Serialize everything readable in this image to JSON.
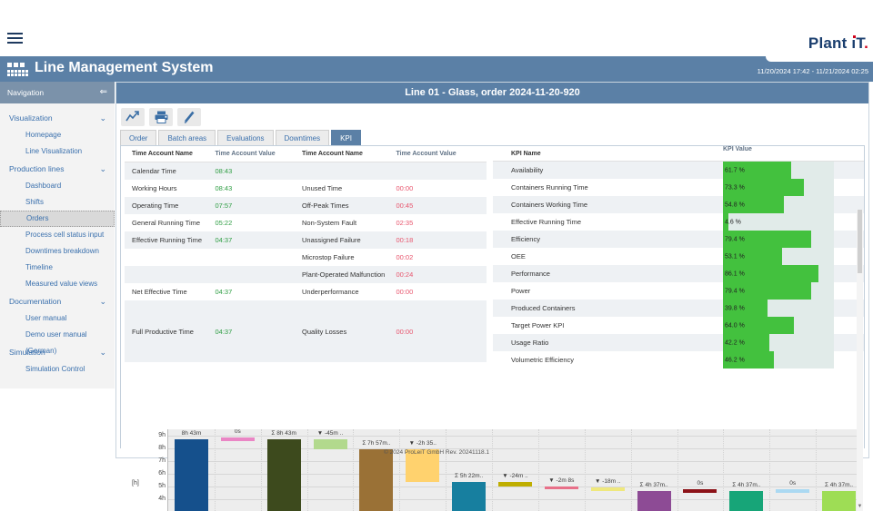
{
  "app": {
    "title": "Line Management System",
    "logo": {
      "plant": "Plant",
      "i": "ı",
      "t": "T",
      "period": "."
    },
    "date_range": "11/20/2024 17:42 - 11/21/2024 02:25"
  },
  "nav": {
    "header": "Navigation",
    "collapse_icon": "⇐",
    "sections": [
      {
        "label": "Visualization",
        "items": [
          "Homepage",
          "Line Visualization"
        ]
      },
      {
        "label": "Production lines",
        "items": [
          "Dashboard",
          "Shifts",
          "Orders",
          "Process cell status input",
          "Downtimes breakdown",
          "Timeline",
          "Measured value views"
        ]
      },
      {
        "label": "Documentation",
        "items": [
          "User manual",
          "Demo user manual (German)"
        ]
      },
      {
        "label": "Simulation",
        "items": [
          "Simulation Control"
        ]
      }
    ],
    "selected_item": "Orders"
  },
  "main": {
    "title": "Line 01 - Glass, order 2024-11-20-920",
    "toolbar": [
      "trend-chart",
      "print",
      "edit"
    ],
    "tabs": [
      "Order",
      "Batch areas",
      "Evaluations",
      "Downtimes",
      "KPI"
    ],
    "active_tab": "KPI"
  },
  "time_accounts": {
    "headers": [
      "Time Account Name",
      "Time Account Value",
      "Time Account Name",
      "Time Account Value"
    ],
    "rows": [
      {
        "n1": "Calendar Time",
        "v1": "08:43",
        "n2": "",
        "v2": ""
      },
      {
        "n1": "Working Hours",
        "v1": "08:43",
        "n2": "Unused Time",
        "v2": "00:00"
      },
      {
        "n1": "Operating Time",
        "v1": "07:57",
        "n2": "Off-Peak Times",
        "v2": "00:45"
      },
      {
        "n1": "General Running Time",
        "v1": "05:22",
        "n2": "Non-System Fault",
        "v2": "02:35"
      },
      {
        "n1": "Effective Running Time",
        "v1": "04:37",
        "n2": "Unassigned Failure",
        "v2": "00:18"
      },
      {
        "n1": "",
        "v1": "",
        "n2": "Microstop Failure",
        "v2": "00:02"
      },
      {
        "n1": "",
        "v1": "",
        "n2": "Plant-Operated Malfunction",
        "v2": "00:24"
      },
      {
        "n1": "Net Effective Time",
        "v1": "04:37",
        "n2": "Underperformance",
        "v2": "00:00"
      },
      {
        "n1": "Full Productive Time",
        "v1": "04:37",
        "n2": "Quality Losses",
        "v2": "00:00",
        "tall": true
      }
    ],
    "value_color_left": "#2f9e44",
    "value_color_right": "#e8556d"
  },
  "kpis": {
    "headers": [
      "KPI Name",
      "KPI Value"
    ],
    "bar_color": "#43c13e",
    "rows": [
      {
        "name": "Availability",
        "value": "61.7 %",
        "pct": 61.7
      },
      {
        "name": "Containers Running Time",
        "value": "73.3 %",
        "pct": 73.3
      },
      {
        "name": "Containers Working Time",
        "value": "54.8 %",
        "pct": 54.8
      },
      {
        "name": "Effective Running Time",
        "value": "4.6 %",
        "pct": 4.6
      },
      {
        "name": "Efficiency",
        "value": "79.4 %",
        "pct": 79.4
      },
      {
        "name": "OEE",
        "value": "53.1 %",
        "pct": 53.1
      },
      {
        "name": "Performance",
        "value": "86.1 %",
        "pct": 86.1
      },
      {
        "name": "Power",
        "value": "79.4 %",
        "pct": 79.4
      },
      {
        "name": "Produced Containers",
        "value": "39.8 %",
        "pct": 39.8
      },
      {
        "name": "Target Power KPI",
        "value": "64.0 %",
        "pct": 64.0
      },
      {
        "name": "Usage Ratio",
        "value": "42.2 %",
        "pct": 42.2
      },
      {
        "name": "Volumetric Efficiency",
        "value": "46.2 %",
        "pct": 46.2
      }
    ]
  },
  "chart_data": {
    "type": "bar",
    "subtype": "waterfall",
    "ylabel": "[h]",
    "yticks": [
      "9h",
      "8h",
      "7h",
      "6h",
      "5h",
      "4h"
    ],
    "ytick_hours": [
      9,
      8,
      7,
      6,
      5,
      4
    ],
    "grid": true,
    "bars": [
      {
        "label": "8h 43m",
        "kind": "total",
        "value_h": 8.72,
        "color": "#15508c"
      },
      {
        "label": "0s",
        "kind": "zero",
        "level_h": 8.72,
        "color": "#ea86c5"
      },
      {
        "label": "Σ 8h 43m",
        "kind": "total",
        "value_h": 8.72,
        "color": "#3d4a1d"
      },
      {
        "label": "▼ -45m ..",
        "kind": "delta",
        "from_h": 8.72,
        "to_h": 7.95,
        "color": "#b2d98d"
      },
      {
        "label": "Σ 7h 57m..",
        "kind": "total",
        "value_h": 7.95,
        "color": "#9a7136"
      },
      {
        "label": "▼ -2h 35..",
        "kind": "delta",
        "from_h": 7.95,
        "to_h": 5.37,
        "color": "#ffd26e"
      },
      {
        "label": "Σ 5h 22m..",
        "kind": "total",
        "value_h": 5.37,
        "color": "#177f9f"
      },
      {
        "label": "▼ -24m ..",
        "kind": "delta",
        "from_h": 5.37,
        "to_h": 4.97,
        "color": "#bfae00"
      },
      {
        "label": "▼ -2m 8s",
        "kind": "delta",
        "from_h": 4.97,
        "to_h": 4.93,
        "color": "#e87089"
      },
      {
        "label": "▼ -18m ..",
        "kind": "delta",
        "from_h": 4.93,
        "to_h": 4.63,
        "color": "#efe87d"
      },
      {
        "label": "Σ 4h 37m..",
        "kind": "total",
        "value_h": 4.62,
        "color": "#8d4b95"
      },
      {
        "label": "0s",
        "kind": "zero",
        "level_h": 4.62,
        "color": "#8c1218"
      },
      {
        "label": "Σ 4h 37m..",
        "kind": "total",
        "value_h": 4.62,
        "color": "#17a578"
      },
      {
        "label": "0s",
        "kind": "zero",
        "level_h": 4.62,
        "color": "#abd9f2"
      },
      {
        "label": "Σ 4h 37m..",
        "kind": "total",
        "value_h": 4.62,
        "color": "#9edd55"
      }
    ]
  },
  "footer": "© 2024 ProLeiT GmbH Rev. 20241118.1"
}
